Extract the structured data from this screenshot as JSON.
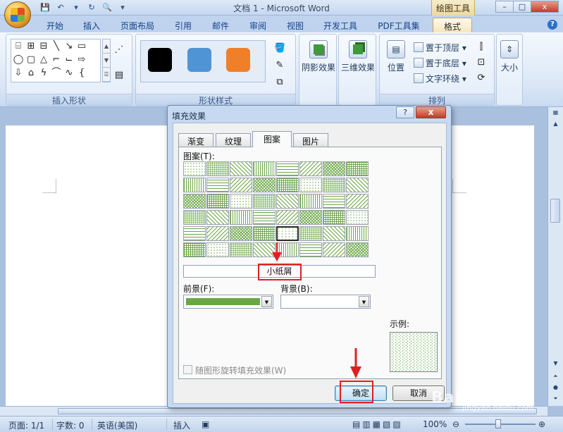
{
  "titlebar": {
    "title": "文档 1 - Microsoft Word",
    "context_tool": "绘图工具",
    "minimize": "–",
    "restore": "□",
    "close": "x"
  },
  "ribbon": {
    "tabs": [
      "开始",
      "插入",
      "页面布局",
      "引用",
      "邮件",
      "审阅",
      "视图",
      "开发工具",
      "PDF工具集",
      "格式"
    ],
    "active_tab": "格式",
    "groups": {
      "insert_shapes": "插入形状",
      "shape_styles": "形状样式",
      "arrange": "排列"
    },
    "style_swatches": [
      "#000000",
      "#4f94d4",
      "#f07f2a"
    ],
    "shadow_effect": "阴影效果",
    "threed_effect": "三维效果",
    "position": "位置",
    "bring_front": "置于顶层",
    "send_back": "置于底层",
    "text_wrap": "文字环绕",
    "size": "大小"
  },
  "dialog": {
    "title": "填充效果",
    "help": "?",
    "close": "x",
    "tabs": [
      "渐变",
      "纹理",
      "图案",
      "图片"
    ],
    "active_tab": "图案",
    "pattern_label": "图案(T):",
    "selected_pattern": "小纸屑",
    "foreground_label": "前景(F):",
    "background_label": "背景(B):",
    "foreground_color": "#6aa745",
    "background_color": "#ffffff",
    "sample_label": "示例:",
    "rotate_checkbox": "随图形旋转填充效果(W)",
    "ok": "确定",
    "cancel": "取消"
  },
  "statusbar": {
    "page": "页面: 1/1",
    "words": "字数: 0",
    "language": "英语(美国)",
    "mode": "插入",
    "zoom": "100%"
  },
  "watermark": {
    "text": "Bai 经验",
    "sub": "jingyan.baidu.com"
  }
}
